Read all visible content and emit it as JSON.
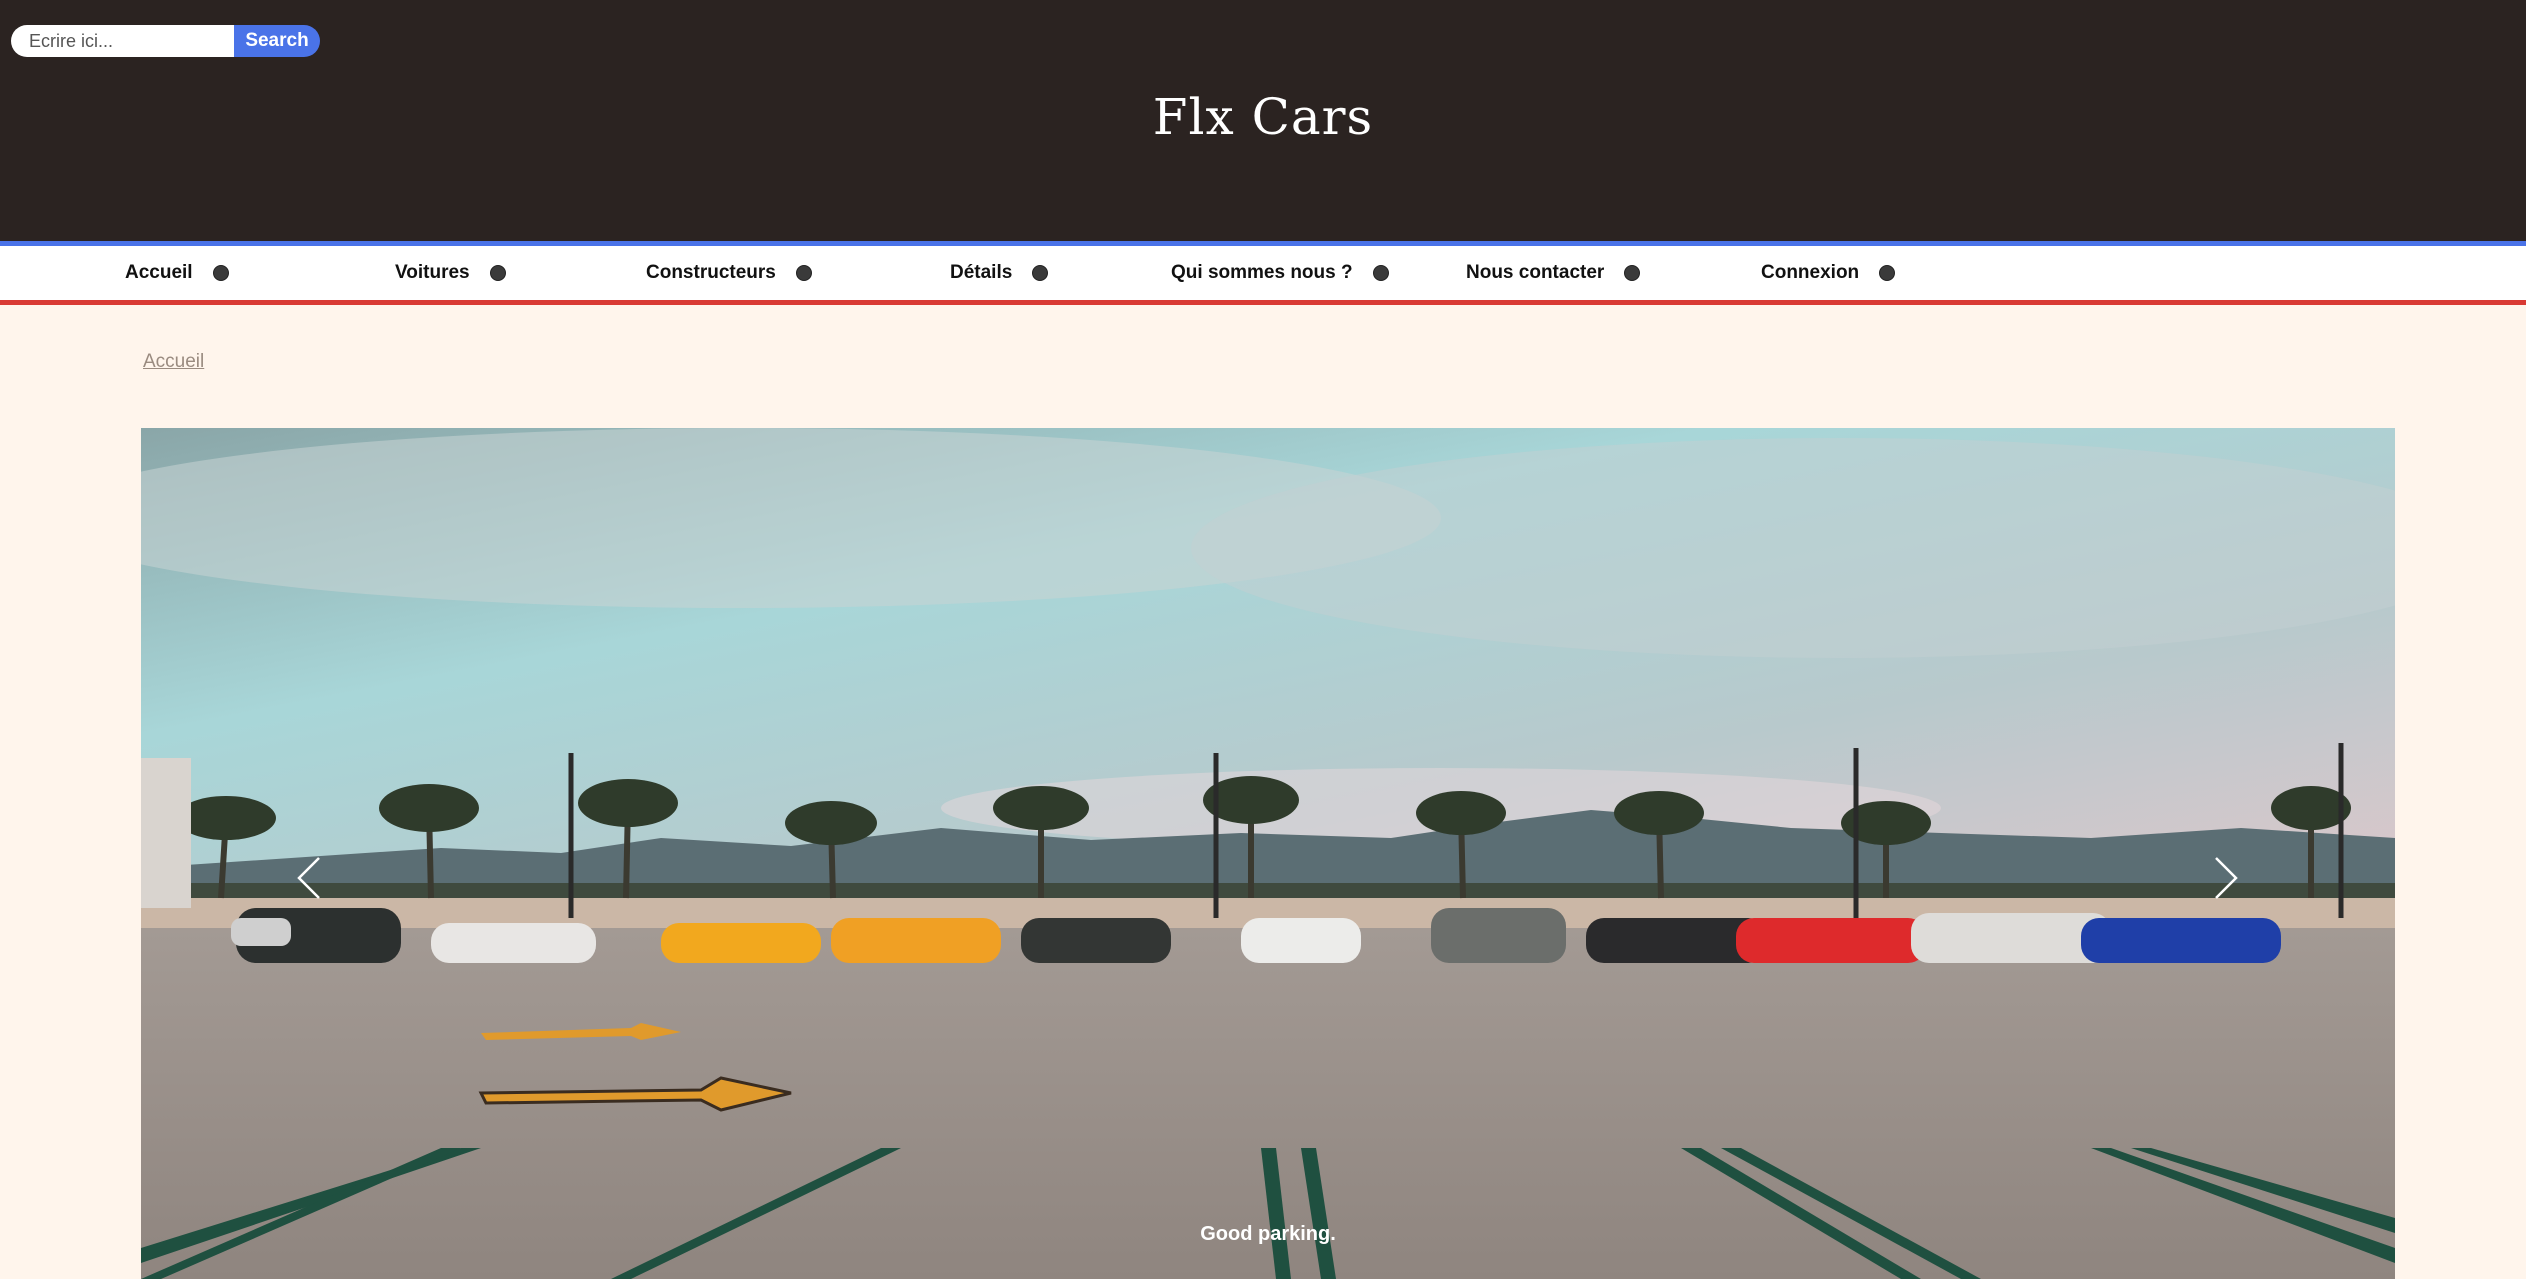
{
  "search": {
    "placeholder": "Ecrire ici...",
    "button_label": "Search"
  },
  "site": {
    "title": "Flx Cars"
  },
  "nav": {
    "items": [
      {
        "label": "Accueil"
      },
      {
        "label": "Voitures"
      },
      {
        "label": "Constructeurs"
      },
      {
        "label": "Détails"
      },
      {
        "label": "Qui sommes nous ?"
      },
      {
        "label": "Nous contacter"
      },
      {
        "label": "Connexion"
      }
    ]
  },
  "breadcrumb": {
    "label": "Accueil"
  },
  "carousel": {
    "caption": "Good parking.",
    "prev_icon": "chevron-left-icon",
    "next_icon": "chevron-right-icon"
  },
  "colors": {
    "header_bg": "#2b2321",
    "page_bg": "#fff5ec",
    "accent_blue": "#4a73e8",
    "accent_red": "#d93a34"
  }
}
